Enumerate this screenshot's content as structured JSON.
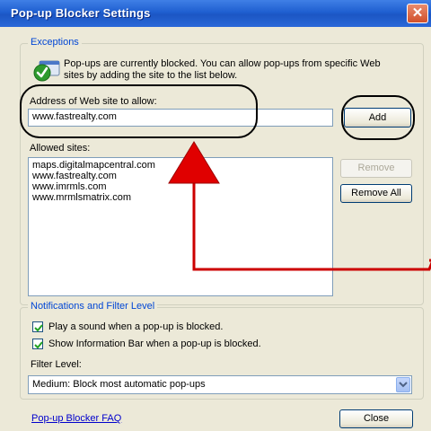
{
  "window": {
    "title": "Pop-up Blocker Settings",
    "close_glyph": "✕"
  },
  "exceptions": {
    "legend": "Exceptions",
    "info_text": "Pop-ups are currently blocked. You can allow pop-ups from specific Web sites by adding the site to the list below.",
    "info_icon": "shield-check-icon",
    "address_label": "Address of Web site to allow:",
    "address_value": "www.fastrealty.com",
    "add_label": "Add",
    "allowed_label": "Allowed sites:",
    "allowed_sites": [
      "maps.digitalmapcentral.com",
      "www.fastrealty.com",
      "www.imrmls.com",
      "www.mrmlsmatrix.com"
    ],
    "remove_label": "Remove",
    "remove_all_label": "Remove All"
  },
  "notifications": {
    "legend": "Notifications and Filter Level",
    "play_sound_label": "Play a sound when a pop-up is blocked.",
    "play_sound_checked": true,
    "info_bar_label": "Show Information Bar when a pop-up is blocked.",
    "info_bar_checked": true,
    "filter_label": "Filter Level:",
    "filter_value": "Medium: Block most automatic pop-ups"
  },
  "footer": {
    "faq_link": "Pop-up Blocker FAQ",
    "close_label": "Close"
  },
  "colors": {
    "title_bar": "#1f5fd0",
    "dialog_bg": "#ece9d8",
    "legend_text": "#0046d5",
    "annotation_arrow": "#e00000",
    "annotation_line": "#cc0000"
  }
}
